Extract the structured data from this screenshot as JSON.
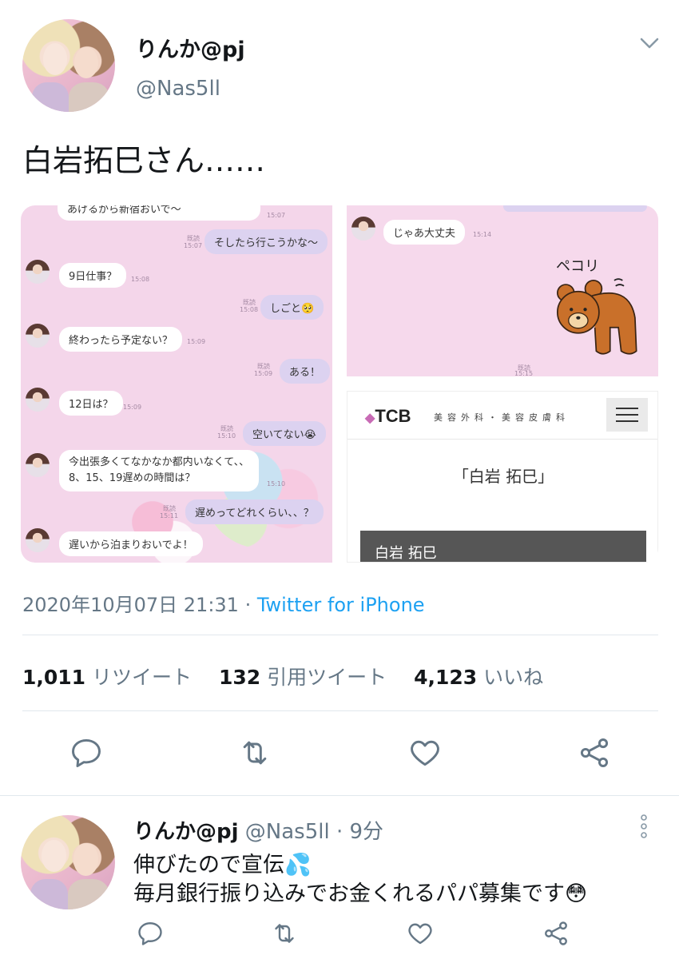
{
  "tweet": {
    "author_name": "りんか@pj",
    "author_handle": "@Nas5ll",
    "text": "白岩拓巳さん……",
    "timestamp": "2020年10月07日 21:31",
    "separator": " · ",
    "source": "Twitter for iPhone",
    "stats": {
      "retweets_count": "1,011",
      "retweets_label": "リツイート",
      "quotes_count": "132",
      "quotes_label": "引用ツイート",
      "likes_count": "4,123",
      "likes_label": "いいね"
    }
  },
  "media": {
    "chat_left": {
      "messages": [
        {
          "text": "あげるから新宿おいで〜",
          "time": "15:07"
        },
        {
          "text": "そしたら行こうかな〜",
          "read": "既読",
          "time": "15:07"
        },
        {
          "text": "9日仕事？",
          "time": "15:08"
        },
        {
          "text": "しごと🥺",
          "read": "既読",
          "time": "15:08"
        },
        {
          "text": "終わったら予定ない？",
          "time": "15:09"
        },
        {
          "text": "ある！",
          "read": "既読",
          "time": "15:09"
        },
        {
          "text": "12日は？",
          "time": "15:09"
        },
        {
          "text": "空いてない😭",
          "read": "既読",
          "time": "15:10"
        },
        {
          "text": "今出張多くてなかなか都内いなくて、、",
          "time": ""
        },
        {
          "text": "8、15、19遅めの時間は？",
          "time": "15:10"
        },
        {
          "text": "遅めってどれくらい、、？",
          "read": "既読",
          "time": "15:11"
        },
        {
          "text": "遅いから泊まりおいでよ！",
          "time": ""
        }
      ]
    },
    "chat_right": {
      "messages": [
        {
          "text": "じゃあ大丈夫",
          "time": "15:14"
        },
        {
          "read": "既読",
          "time": "15:15"
        }
      ],
      "sticker_text": "ペコリ"
    },
    "tcb": {
      "logo": "TCB",
      "subtitle": "美容外科・美容皮膚科",
      "name_title": "「白岩 拓巳」",
      "name_bar": "白岩 拓巳"
    }
  },
  "reply": {
    "author_name": "りんか@pj",
    "author_handle": "@Nas5ll",
    "time_ago": "· 9分",
    "line1": "伸びたので宣伝💦",
    "line2": "毎月銀行振り込みでお金くれるパパ募集です😳"
  },
  "colors": {
    "link_blue": "#1da1f2",
    "secondary_gray": "#657786",
    "text_dark": "#14171a",
    "divider": "#e1e8ed",
    "chat_pink": "#f4d6ea"
  },
  "icons": [
    "chevron-down-icon",
    "reply-icon",
    "retweet-icon",
    "like-icon",
    "share-icon",
    "more-vertical-icon"
  ]
}
